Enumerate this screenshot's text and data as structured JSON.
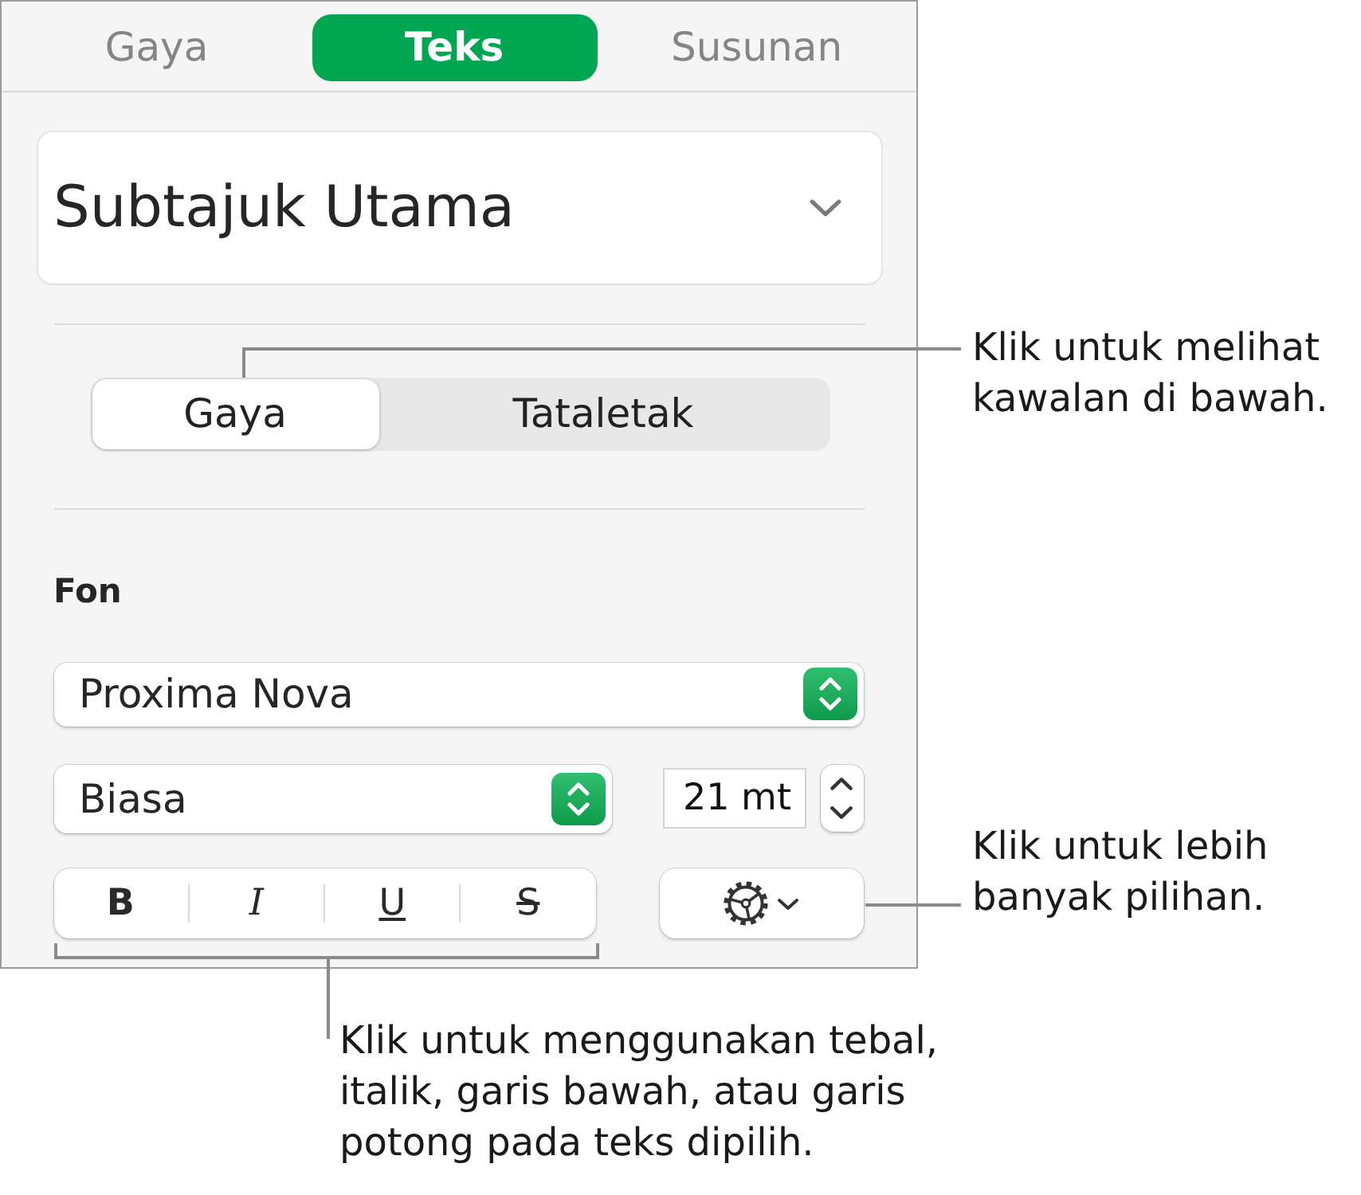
{
  "inspector_tabs": [
    {
      "label": "Gaya",
      "selected": false
    },
    {
      "label": "Teks",
      "selected": true
    },
    {
      "label": "Susunan",
      "selected": false
    }
  ],
  "paragraph_style": {
    "value": "Subtajuk Utama"
  },
  "view_switch": [
    {
      "label": "Gaya",
      "selected": true
    },
    {
      "label": "Tataletak",
      "selected": false
    }
  ],
  "font": {
    "heading": "Fon",
    "family": "Proxima Nova",
    "typeface": "Biasa",
    "size": "21 mt"
  },
  "text_format_buttons": [
    {
      "label": "B",
      "kind": "bold"
    },
    {
      "label": "I",
      "kind": "italic"
    },
    {
      "label": "U",
      "kind": "underline"
    },
    {
      "label": "S",
      "kind": "strikethrough"
    }
  ],
  "callouts": [
    {
      "text": "Klik untuk melihat\nkawalan di bawah."
    },
    {
      "text": "Klik untuk lebih\nbanyak pilihan."
    },
    {
      "text": "Klik untuk menggunakan tebal,\nitalik, garis bawah, atau garis\npotong pada teks dipilih."
    }
  ]
}
